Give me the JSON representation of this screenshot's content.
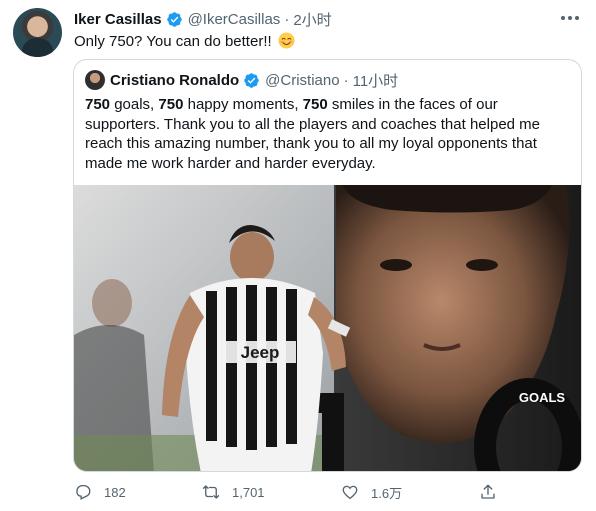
{
  "tweet": {
    "author_name": "Iker Casillas",
    "author_handle": "@IkerCasillas",
    "separator": "·",
    "time": "2小时",
    "text": "Only 750? You can do better!!",
    "emoji": "smiling-face-emoji"
  },
  "quoted": {
    "author_name": "Cristiano Ronaldo",
    "author_handle": "@Cristiano",
    "separator": "·",
    "time": "11小时",
    "text": {
      "n1": "750",
      "t1": " goals, ",
      "n2": "750",
      "t2": " happy moments, ",
      "n3": "750",
      "t3": " smiles in the faces of our supporters. Thank you to all the players and coaches that helped me reach this amazing number, thank you to all my loyal opponents that made me work harder and harder everyday."
    },
    "image_caption": "GOALS",
    "jersey_text": "Jeep"
  },
  "actions": {
    "reply_count": "182",
    "retweet_count": "1,701",
    "like_count": "1.6万"
  },
  "icons": {
    "verified": "verified-badge-icon",
    "more": "more-options-icon",
    "reply": "reply-icon",
    "retweet": "retweet-icon",
    "like": "like-icon",
    "share": "share-icon"
  },
  "colors": {
    "verified_blue": "#1d9bf0",
    "text_primary": "#0f1419",
    "text_secondary": "#536471",
    "border": "#cfd9de"
  }
}
